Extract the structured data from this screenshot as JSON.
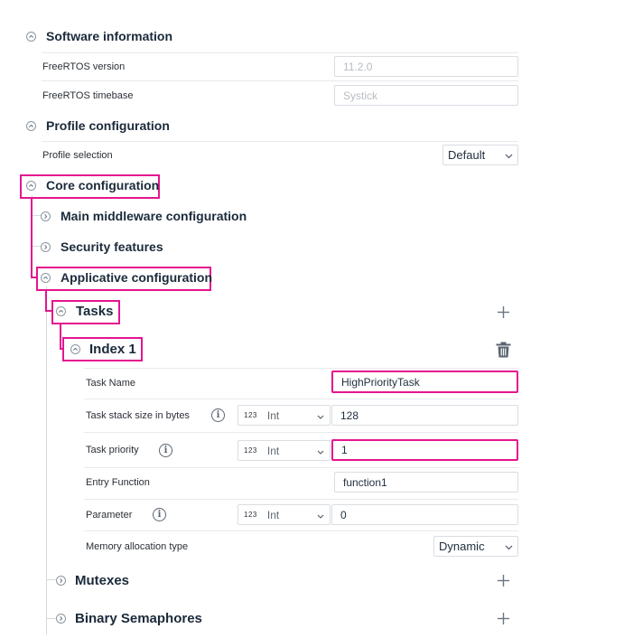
{
  "software": {
    "title": "Software information",
    "freertos_version_label": "FreeRTOS version",
    "freertos_version_value": "11.2.0",
    "freertos_timebase_label": "FreeRTOS timebase",
    "freertos_timebase_value": "Systick"
  },
  "profile": {
    "title": "Profile configuration",
    "selection_label": "Profile selection",
    "selection_value": "Default"
  },
  "core": {
    "title": "Core configuration",
    "main_middleware": "Main middleware configuration",
    "security": "Security features",
    "applicative": "Applicative configuration"
  },
  "tasks": {
    "title": "Tasks",
    "index_title": "Index 1",
    "task_name_label": "Task Name",
    "task_name_value": "HighPriorityTask",
    "stack_label": "Task stack size in bytes",
    "stack_type_badge": "123",
    "stack_type": "Int",
    "stack_value": "128",
    "priority_label": "Task priority",
    "priority_type_badge": "123",
    "priority_type": "Int",
    "priority_value": "1",
    "entry_label": "Entry Function",
    "entry_value": "function1",
    "parameter_label": "Parameter",
    "parameter_type_badge": "123",
    "parameter_type": "Int",
    "parameter_value": "0",
    "memory_label": "Memory allocation type",
    "memory_value": "Dynamic"
  },
  "mutexes": {
    "title": "Mutexes"
  },
  "binary_semaphores": {
    "title": "Binary Semaphores"
  },
  "colors": {
    "highlight": "#e5158f",
    "border": "#d9dde2",
    "title": "#1b2a3a"
  },
  "icons": [
    "collapse-icon",
    "expand-icon",
    "chevron-down-icon",
    "info-icon",
    "plus-icon",
    "trash-icon"
  ]
}
